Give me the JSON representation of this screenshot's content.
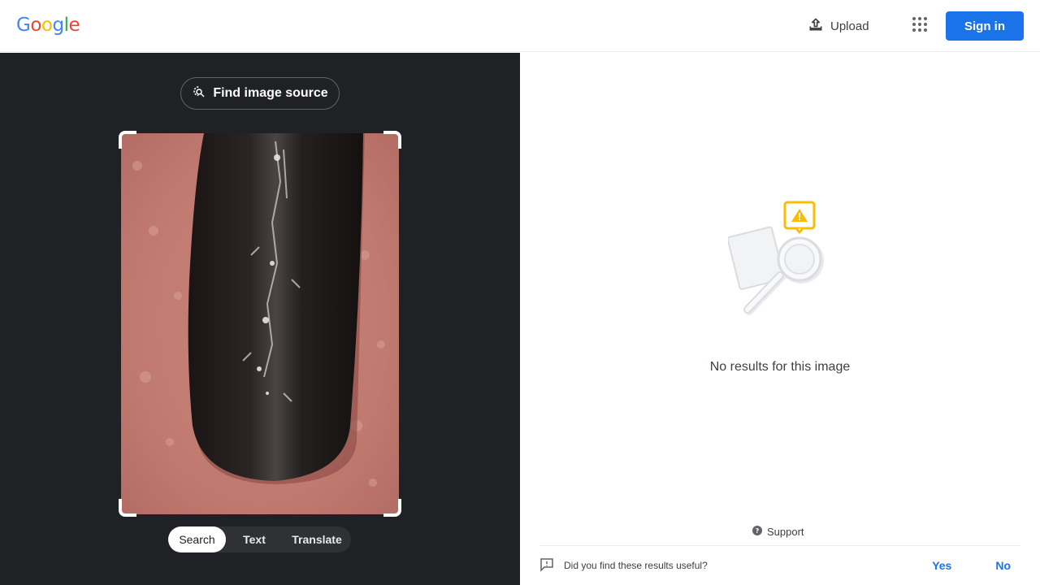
{
  "header": {
    "logo_letters": [
      "G",
      "o",
      "o",
      "g",
      "l",
      "e"
    ],
    "logo_colors": [
      "#4285f4",
      "#ea4335",
      "#fbbc05",
      "#4285f4",
      "#34a853",
      "#ea4335"
    ],
    "upload_label": "Upload",
    "signin_label": "Sign in",
    "apps_icon": "apps-grid-icon"
  },
  "left_panel": {
    "find_source_label": "Find image source",
    "find_source_icon": "lens-search-icon",
    "modes": [
      {
        "label": "Search",
        "active": true
      },
      {
        "label": "Text",
        "active": false
      },
      {
        "label": "Translate",
        "active": false
      }
    ]
  },
  "right_panel": {
    "no_results_text": "No results for this image",
    "support_label": "Support",
    "feedback_question": "Did you find these results useful?",
    "feedback_yes": "Yes",
    "feedback_no": "No"
  },
  "colors": {
    "accent": "#1a73e8",
    "left_bg": "#202124",
    "warning": "#fbbc05"
  }
}
